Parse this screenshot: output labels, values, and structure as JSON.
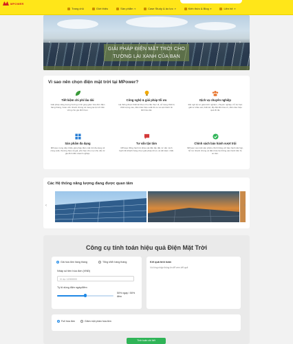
{
  "header": {
    "logo_text": "MPOWER",
    "nav": [
      {
        "label": "Trang chủ",
        "icon": "home-icon",
        "has_caret": false
      },
      {
        "label": "Giới thiệu",
        "icon": "info-icon",
        "has_caret": false
      },
      {
        "label": "Sản phẩm",
        "icon": "box-icon",
        "has_caret": true
      },
      {
        "label": "Case Study & ảo lực",
        "icon": "briefcase-icon",
        "has_caret": true
      },
      {
        "label": "Kiến thức & Blog",
        "icon": "book-icon",
        "has_caret": true
      },
      {
        "label": "Liên hệ",
        "icon": "phone-icon",
        "has_caret": true
      }
    ]
  },
  "banner": {
    "caption_line1": "GIẢI PHÁP ĐIỆN MẶT TRỜI CHO",
    "caption_line2": "TƯƠNG LAI XANH CỦA BẠN"
  },
  "why": {
    "title": "Vì sao nên chọn điện mặt trời tại MPower?",
    "features": [
      {
        "icon": "leaf-icon",
        "color": "#3a9a3a",
        "title": "Tiết kiệm chi phí lâu dài",
        "desc": "Giải pháp năng lượng hướng mình giúp giảm hóa đơn điện hàng tháng, hoàn vốn nhanh chóng và mang lại lợi ích bền vững cho gia đình bạn."
      },
      {
        "icon": "lightbulb-icon",
        "color": "#f2a900",
        "title": "Công nghệ & giải pháp tối ưu",
        "desc": "Hệ thống được thiết kế theo nhu cầu thực tế, sử dụng thiết bị chất lượng cao, đảm bảo hiệu suất tối ưu và vận hành ổn định lâu dài."
      },
      {
        "icon": "team-icon",
        "color": "#e8732a",
        "title": "Dịch vụ chuyên nghiệp",
        "desc": "Đội ngũ kỹ sư giàu kinh nghiệm, chuyên nghiệp, hỗ trợ bạn giải tư khảo sát, thiết kế, lắp đặt đến bảo trì, đảm bảo hiệu quả tối đa."
      },
      {
        "icon": "grid-icon",
        "color": "#2a7fd4",
        "title": "Sản phẩm đa dạng",
        "desc": "MPower cung cấp nhiều giải pháp điện mặt trời đa dạng về công suất, thương hiệu và giá, phù hợp cho mọi nhu cầu từ gia đình đến doanh nghiệp."
      },
      {
        "icon": "chat-icon",
        "color": "#d43a3a",
        "title": "Tư vấn tận tâm",
        "desc": "MPower đồng hành từ khảo sát đến lắp đặt, từ vấn minh bạch để khách hàng chọn giải pháp tối ưu và tiết kiệm nhất."
      },
      {
        "icon": "check-badge-icon",
        "color": "#2fb457",
        "title": "Chính sách bảo hành vượt trội",
        "desc": "MPower cam kết sản phẩm chính hãng với bảo hành dài hạn, hỗ trợ nhanh chóng và đảm bảo hệ thống vận hành bền bỉ, an tâm."
      }
    ]
  },
  "systems": {
    "title": "Các Hệ thống năng lượng đang được quan tâm"
  },
  "calculator": {
    "title": "Công cụ tính toán hiệu quả Điện Mặt Trời",
    "mode_options": [
      "Giá hóa đơn hàng tháng",
      "Tổng kWh hàng tháng"
    ],
    "mode_selected_index": 0,
    "bill_label": "Nhập số tiền hóa đơn (VNĐ)",
    "bill_placeholder": "Ví dụ: 12000000",
    "ratio_label": "Tỷ lệ dùng điện ngày/đêm",
    "ratio_value": "50% ngày / 50% đêm",
    "ratio_fraction": 0.5,
    "result_title": "Kết quả tính toán",
    "result_hint": "Vui lòng nhập thông tin để xem kết quả",
    "payment_options": [
      "Full hóa đơn",
      "Giảm một phần hóa đơn"
    ],
    "payment_selected_index": 0,
    "submit_label": "Tính toán chi tiết"
  }
}
